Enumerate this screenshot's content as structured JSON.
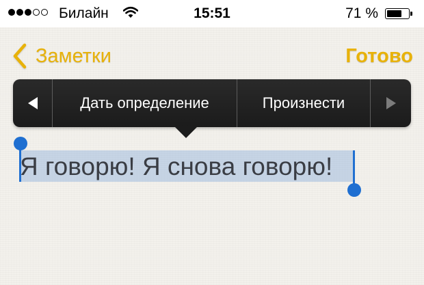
{
  "status_bar": {
    "carrier": "Билайн",
    "time": "15:51",
    "battery_percent": "71 %",
    "battery_level": 0.71,
    "signal_bars_filled": 3,
    "signal_bars_total": 5,
    "icons": [
      "signal-dots-icon",
      "wifi-icon",
      "battery-icon"
    ]
  },
  "nav": {
    "back_label": "Заметки",
    "done_label": "Готово",
    "accent_color": "#e8b20a"
  },
  "edit_menu": {
    "items": [
      {
        "icon": "triangle-left-icon",
        "enabled": true
      },
      {
        "label": "Дать определение"
      },
      {
        "label": "Произнести"
      },
      {
        "icon": "triangle-right-icon",
        "enabled": false
      }
    ]
  },
  "note": {
    "text": "Я говорю! Я снова говорю!",
    "selected": true,
    "selection_color": "#1f6fd1"
  }
}
